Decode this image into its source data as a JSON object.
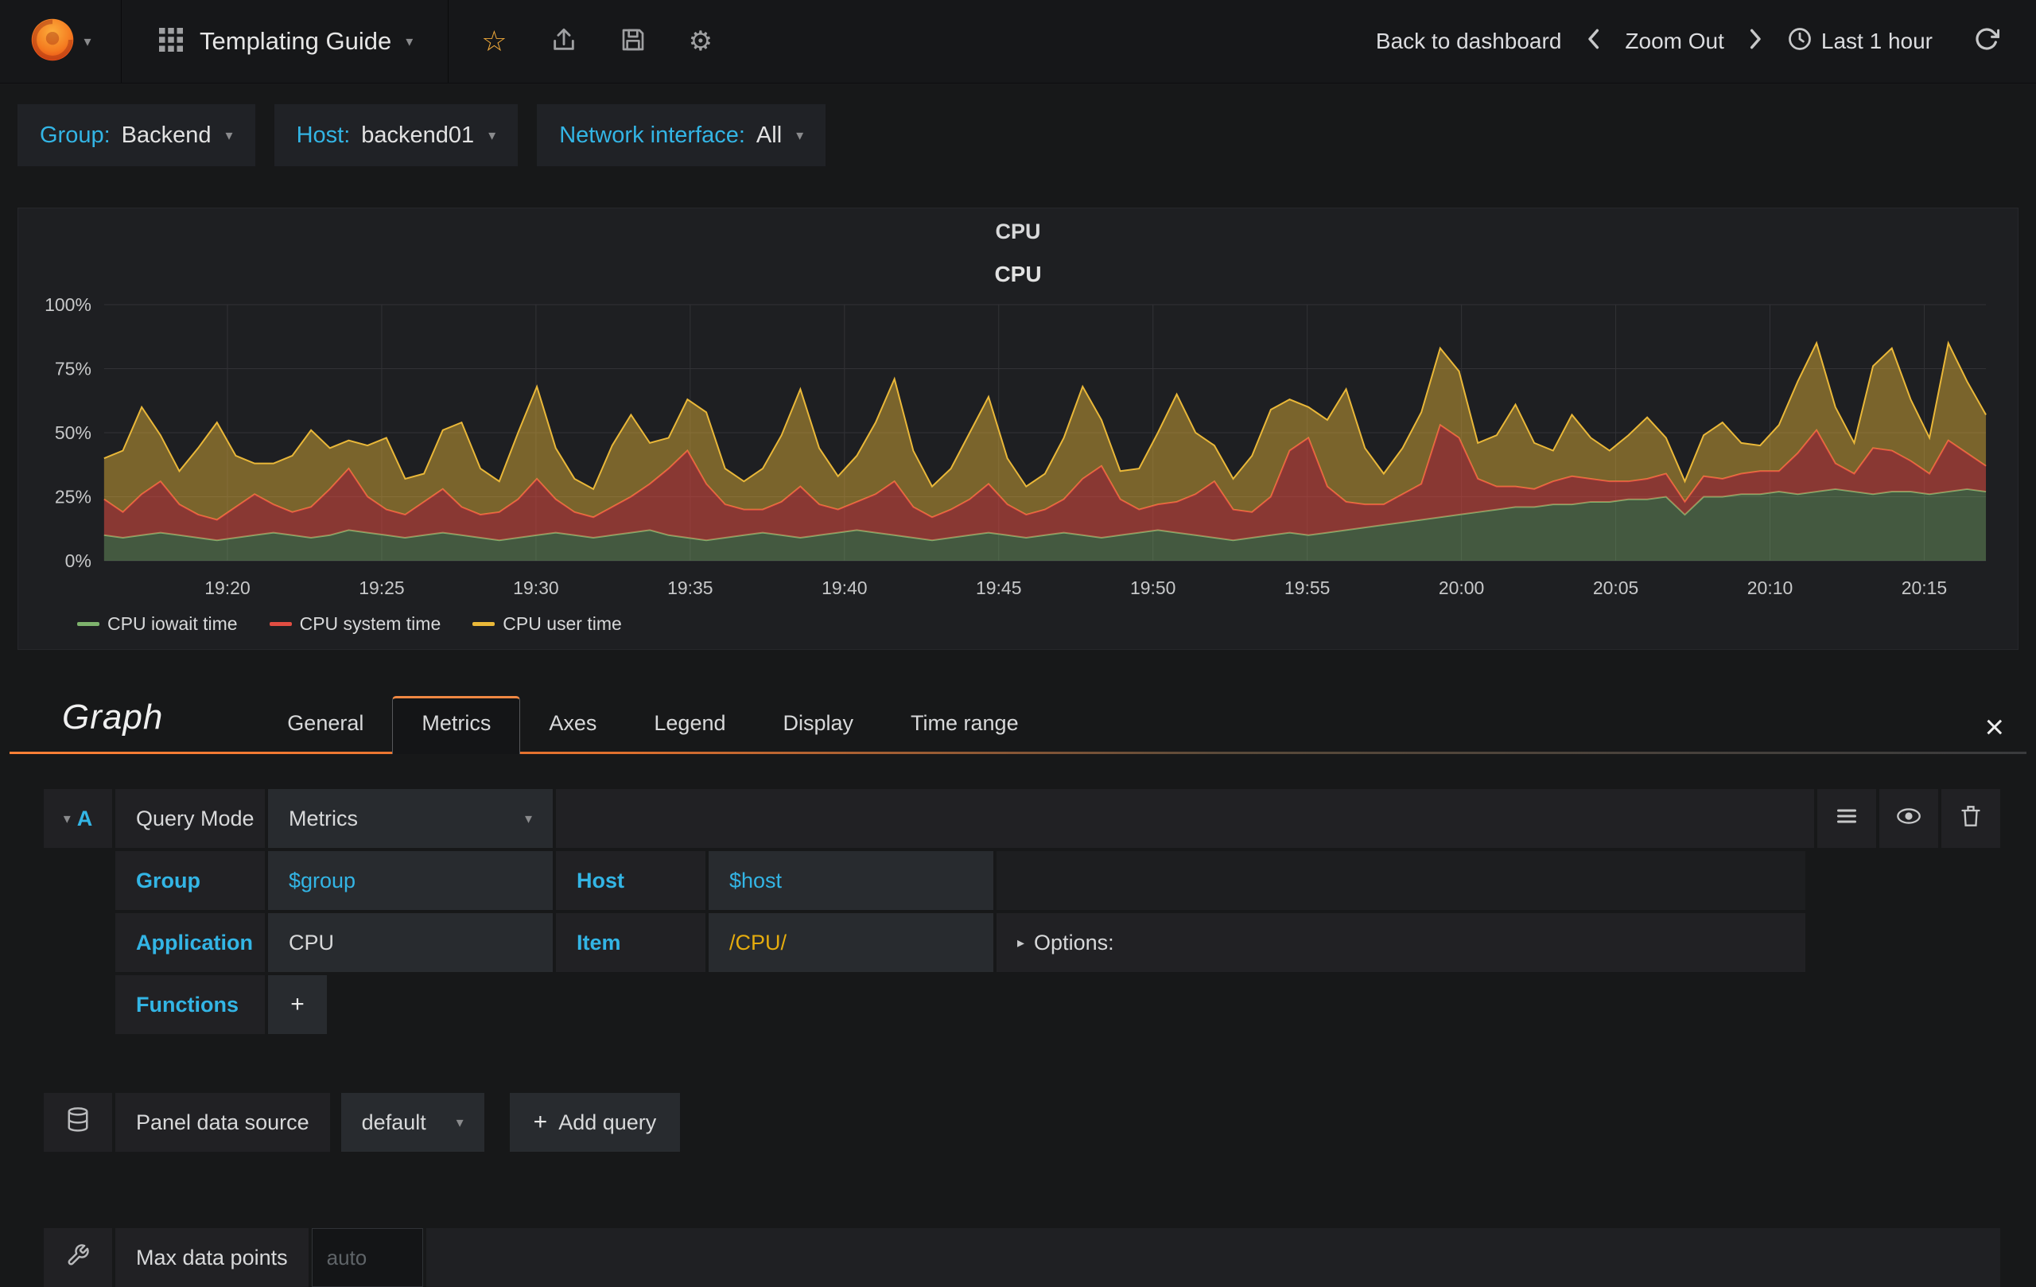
{
  "navbar": {
    "dashboard_title": "Templating Guide",
    "back_to_dashboard": "Back to dashboard",
    "zoom_out": "Zoom Out",
    "time_range": "Last 1 hour"
  },
  "template_vars": [
    {
      "label": "Group:",
      "value": "Backend"
    },
    {
      "label": "Host:",
      "value": "backend01"
    },
    {
      "label": "Network interface:",
      "value": "All"
    }
  ],
  "panel": {
    "title": "CPU"
  },
  "chart_data": {
    "type": "area",
    "stacked": true,
    "title": "CPU",
    "xlabel": "",
    "ylabel": "",
    "ylim": [
      0,
      100
    ],
    "y_ticks": [
      "0%",
      "25%",
      "50%",
      "75%",
      "100%"
    ],
    "y_tick_values": [
      0,
      25,
      50,
      75,
      100
    ],
    "x_domain": [
      0,
      61
    ],
    "x_domain_note": "minutes after 19:16, total window Last 1 hour",
    "x_ticks": [
      {
        "t": 4,
        "label": "19:20"
      },
      {
        "t": 9,
        "label": "19:25"
      },
      {
        "t": 14,
        "label": "19:30"
      },
      {
        "t": 19,
        "label": "19:35"
      },
      {
        "t": 24,
        "label": "19:40"
      },
      {
        "t": 29,
        "label": "19:45"
      },
      {
        "t": 34,
        "label": "19:50"
      },
      {
        "t": 39,
        "label": "19:55"
      },
      {
        "t": 44,
        "label": "20:00"
      },
      {
        "t": 49,
        "label": "20:05"
      },
      {
        "t": 54,
        "label": "20:10"
      },
      {
        "t": 59,
        "label": "20:15"
      }
    ],
    "grid": true,
    "legend_position": "bottom-left",
    "series": [
      {
        "name": "CPU iowait time",
        "color": "#7EB26D",
        "fill_opacity": 0.4,
        "values": [
          10,
          9,
          10,
          11,
          10,
          9,
          8,
          9,
          10,
          11,
          10,
          9,
          10,
          12,
          11,
          10,
          9,
          10,
          11,
          10,
          9,
          8,
          9,
          10,
          11,
          10,
          9,
          10,
          11,
          12,
          10,
          9,
          8,
          9,
          10,
          11,
          10,
          9,
          10,
          11,
          12,
          11,
          10,
          9,
          8,
          9,
          10,
          11,
          10,
          9,
          10,
          11,
          10,
          9,
          10,
          11,
          12,
          11,
          10,
          9,
          8,
          9,
          10,
          11,
          10,
          11,
          12,
          13,
          14,
          15,
          16,
          17,
          18,
          19,
          20,
          21,
          21,
          22,
          22,
          23,
          23,
          24,
          24,
          25,
          18,
          25,
          25,
          26,
          26,
          27,
          26,
          27,
          28,
          27,
          26,
          27,
          27,
          26,
          27,
          28,
          27
        ]
      },
      {
        "name": "CPU system time",
        "color": "#E24D42",
        "fill_opacity": 0.55,
        "values": [
          14,
          10,
          16,
          20,
          12,
          9,
          8,
          12,
          16,
          11,
          9,
          12,
          18,
          24,
          14,
          10,
          9,
          13,
          17,
          11,
          9,
          11,
          15,
          22,
          13,
          9,
          8,
          11,
          14,
          18,
          26,
          34,
          22,
          13,
          10,
          9,
          13,
          20,
          12,
          9,
          11,
          15,
          21,
          12,
          9,
          11,
          14,
          19,
          12,
          9,
          10,
          13,
          22,
          28,
          14,
          9,
          10,
          12,
          16,
          22,
          12,
          10,
          15,
          32,
          38,
          18,
          11,
          9,
          8,
          11,
          14,
          36,
          30,
          13,
          9,
          8,
          7,
          9,
          11,
          9,
          8,
          7,
          8,
          9,
          5,
          8,
          7,
          8,
          9,
          8,
          16,
          24,
          10,
          7,
          18,
          16,
          12,
          8,
          20,
          14,
          10
        ]
      },
      {
        "name": "CPU user time",
        "color": "#EAB839",
        "fill_opacity": 0.45,
        "values": [
          16,
          24,
          34,
          18,
          13,
          26,
          38,
          20,
          12,
          16,
          22,
          30,
          16,
          11,
          20,
          28,
          14,
          11,
          23,
          33,
          18,
          12,
          26,
          36,
          20,
          13,
          11,
          24,
          32,
          16,
          12,
          20,
          28,
          14,
          11,
          16,
          26,
          38,
          22,
          13,
          18,
          28,
          40,
          22,
          12,
          16,
          26,
          34,
          18,
          11,
          14,
          24,
          36,
          18,
          11,
          16,
          28,
          42,
          24,
          14,
          12,
          22,
          34,
          20,
          12,
          26,
          44,
          22,
          12,
          18,
          28,
          30,
          26,
          14,
          20,
          32,
          18,
          12,
          24,
          16,
          12,
          18,
          24,
          14,
          8,
          16,
          22,
          12,
          10,
          18,
          28,
          34,
          22,
          12,
          32,
          40,
          24,
          14,
          38,
          28,
          20
        ]
      }
    ]
  },
  "editor": {
    "panel_type": "Graph",
    "tabs": [
      "General",
      "Metrics",
      "Axes",
      "Legend",
      "Display",
      "Time range"
    ],
    "active_tab": "Metrics",
    "query": {
      "ref": "A",
      "query_mode_label": "Query Mode",
      "query_mode_value": "Metrics",
      "fields": {
        "group": {
          "label": "Group",
          "value": "$group"
        },
        "host": {
          "label": "Host",
          "value": "$host"
        },
        "application": {
          "label": "Application",
          "value": "CPU"
        },
        "item": {
          "label": "Item",
          "value": "/CPU/"
        }
      },
      "options_label": "Options:",
      "functions_label": "Functions"
    },
    "datasource": {
      "label": "Panel data source",
      "value": "default",
      "add_query_label": "Add query"
    },
    "max_data_points": {
      "label": "Max data points",
      "placeholder": "auto"
    }
  },
  "icons": {
    "star": "☆",
    "gear": "⚙",
    "caret_down": "▾",
    "caret_right": "▸",
    "plus": "+",
    "close": "×"
  }
}
